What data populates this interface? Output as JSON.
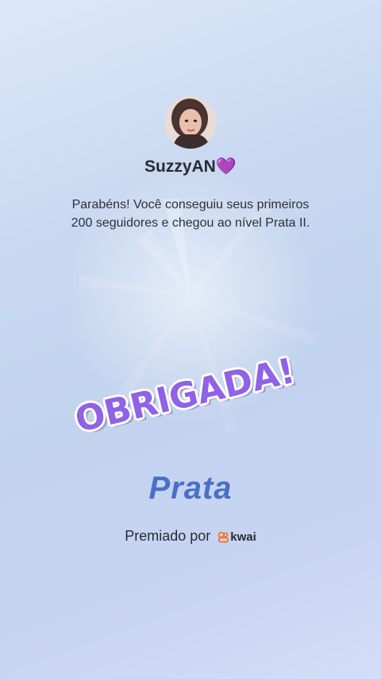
{
  "profile": {
    "username": "SuzzyAN",
    "username_emoji": "💜",
    "avatar_icon": "user-photo"
  },
  "message": {
    "line1": "Parabéns! Você conseguiu seus primeiros",
    "line2": "200 seguidores e chegou ao nível Prata II."
  },
  "sticker": {
    "text": "OBRIGADA!"
  },
  "level": {
    "name": "Prata"
  },
  "footer": {
    "awarded_by": "Premiado por",
    "brand": "kwai",
    "brand_icon": "kwai-logo-icon"
  },
  "colors": {
    "sticker_purple": "#8f62e6",
    "level_blue": "#4a6fc6",
    "brand_orange": "#ff6a1f"
  }
}
